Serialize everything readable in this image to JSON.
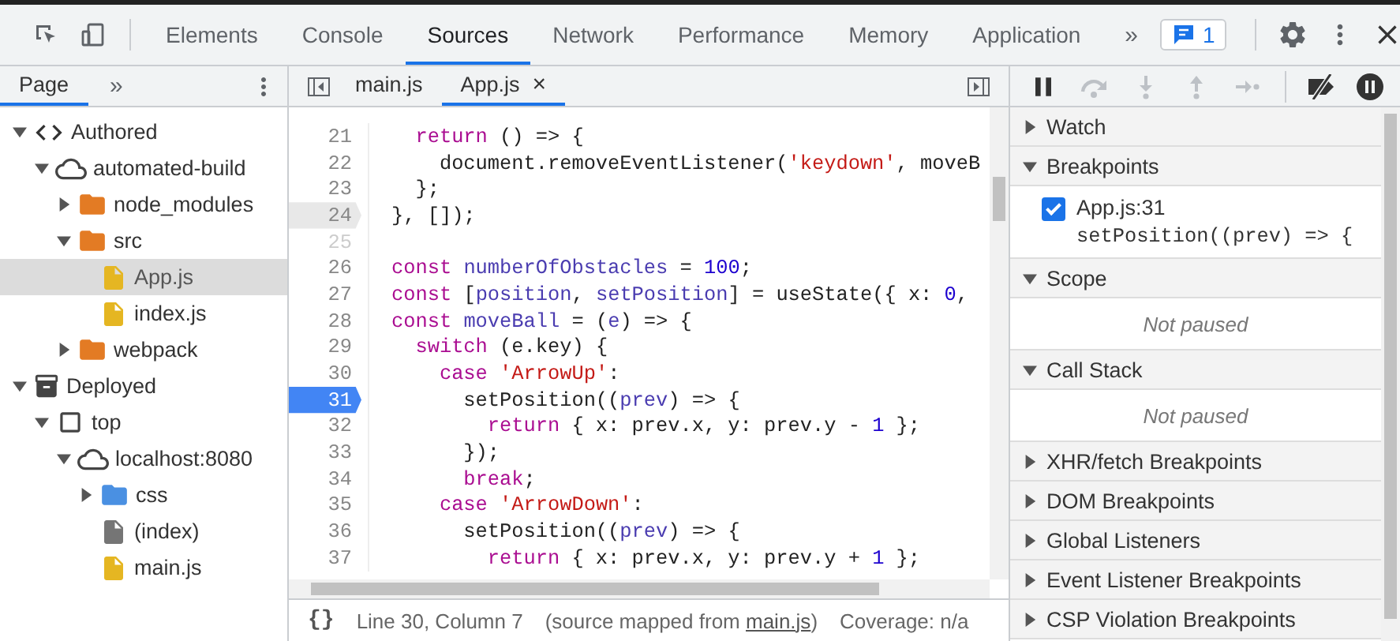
{
  "toolbar": {
    "tabs": [
      {
        "label": "Elements",
        "selected": false
      },
      {
        "label": "Console",
        "selected": false
      },
      {
        "label": "Sources",
        "selected": true
      },
      {
        "label": "Network",
        "selected": false
      },
      {
        "label": "Performance",
        "selected": false
      },
      {
        "label": "Memory",
        "selected": false
      },
      {
        "label": "Application",
        "selected": false
      }
    ],
    "overflow": "»",
    "issues_badge": "1"
  },
  "navigator": {
    "tabs": [
      {
        "label": "Page",
        "selected": true
      }
    ],
    "overflow": "»",
    "tree": [
      {
        "label": "Authored",
        "kind": "code",
        "expanded": true,
        "selected": false,
        "children": [
          {
            "label": "automated-build",
            "kind": "cloud",
            "expanded": true,
            "selected": false,
            "children": [
              {
                "label": "node_modules",
                "kind": "folder",
                "color": "#e37b24",
                "expanded": false,
                "selected": false
              },
              {
                "label": "src",
                "kind": "folder",
                "color": "#e37b24",
                "expanded": true,
                "selected": false,
                "children": [
                  {
                    "label": "App.js",
                    "kind": "file",
                    "color": "#e5b622",
                    "selected": true
                  },
                  {
                    "label": "index.js",
                    "kind": "file",
                    "color": "#e5b622",
                    "selected": false
                  }
                ]
              },
              {
                "label": "webpack",
                "kind": "folder",
                "color": "#e37b24",
                "expanded": false,
                "selected": false
              }
            ]
          }
        ]
      },
      {
        "label": "Deployed",
        "kind": "package",
        "expanded": true,
        "selected": false,
        "children": [
          {
            "label": "top",
            "kind": "frame",
            "expanded": true,
            "selected": false,
            "children": [
              {
                "label": "localhost:8080",
                "kind": "cloud",
                "expanded": true,
                "selected": false,
                "children": [
                  {
                    "label": "css",
                    "kind": "folder",
                    "color": "#4a90e2",
                    "expanded": false,
                    "selected": false
                  },
                  {
                    "label": "(index)",
                    "kind": "file",
                    "color": "#757575",
                    "selected": false
                  },
                  {
                    "label": "main.js",
                    "kind": "file",
                    "color": "#e5b622",
                    "selected": false
                  }
                ]
              }
            ]
          }
        ]
      }
    ]
  },
  "editor": {
    "tabs": [
      {
        "label": "main.js",
        "selected": false
      },
      {
        "label": "App.js",
        "selected": true,
        "close": "×"
      }
    ],
    "lines": [
      {
        "number": "21",
        "breakpoint": false,
        "breakpoint_disabled": false,
        "breakable": true,
        "tokens": [
          {
            "kind": "kw",
            "text": "  return"
          },
          {
            "kind": "plain",
            "text": " () => {"
          }
        ]
      },
      {
        "number": "22",
        "breakpoint": false,
        "breakpoint_disabled": false,
        "breakable": true,
        "tokens": [
          {
            "kind": "plain",
            "text": "    document.removeEventListener("
          },
          {
            "kind": "str",
            "text": "'keydown'"
          },
          {
            "kind": "plain",
            "text": ", moveB"
          }
        ]
      },
      {
        "number": "23",
        "breakpoint": false,
        "breakpoint_disabled": false,
        "breakable": true,
        "tokens": [
          {
            "kind": "plain",
            "text": "  };"
          }
        ]
      },
      {
        "number": "24",
        "breakpoint": false,
        "breakpoint_disabled": true,
        "breakable": true,
        "tokens": [
          {
            "kind": "plain",
            "text": "}, []);"
          }
        ]
      },
      {
        "number": "25",
        "breakpoint": false,
        "breakpoint_disabled": false,
        "breakable": false
      },
      {
        "number": "26",
        "breakpoint": false,
        "breakpoint_disabled": false,
        "breakable": true,
        "tokens": [
          {
            "kind": "kw",
            "text": "const "
          },
          {
            "kind": "def",
            "text": "numberOfObstacles"
          },
          {
            "kind": "plain",
            "text": " = "
          },
          {
            "kind": "num",
            "text": "100"
          },
          {
            "kind": "plain",
            "text": ";"
          }
        ]
      },
      {
        "number": "27",
        "breakpoint": false,
        "breakpoint_disabled": false,
        "breakable": true,
        "tokens": [
          {
            "kind": "kw",
            "text": "const"
          },
          {
            "kind": "plain",
            "text": " ["
          },
          {
            "kind": "def",
            "text": "position"
          },
          {
            "kind": "plain",
            "text": ", "
          },
          {
            "kind": "def",
            "text": "setPosition"
          },
          {
            "kind": "plain",
            "text": "] = useState({ x: "
          },
          {
            "kind": "num",
            "text": "0"
          },
          {
            "kind": "plain",
            "text": ","
          }
        ]
      },
      {
        "number": "28",
        "breakpoint": false,
        "breakpoint_disabled": false,
        "breakable": true,
        "tokens": [
          {
            "kind": "kw",
            "text": "const "
          },
          {
            "kind": "def",
            "text": "moveBall"
          },
          {
            "kind": "plain",
            "text": " = ("
          },
          {
            "kind": "def",
            "text": "e"
          },
          {
            "kind": "plain",
            "text": ") => {"
          }
        ]
      },
      {
        "number": "29",
        "breakpoint": false,
        "breakpoint_disabled": false,
        "breakable": true,
        "tokens": [
          {
            "kind": "kw",
            "text": "  switch"
          },
          {
            "kind": "plain",
            "text": " (e.key) {"
          }
        ]
      },
      {
        "number": "30",
        "breakpoint": false,
        "breakpoint_disabled": false,
        "breakable": true,
        "tokens": [
          {
            "kind": "kw",
            "text": "    case "
          },
          {
            "kind": "str",
            "text": "'ArrowUp'"
          },
          {
            "kind": "plain",
            "text": ":"
          }
        ]
      },
      {
        "number": "31",
        "breakpoint": true,
        "breakpoint_disabled": false,
        "breakable": true,
        "tokens": [
          {
            "kind": "plain",
            "text": "      setPosition(("
          },
          {
            "kind": "def",
            "text": "prev"
          },
          {
            "kind": "plain",
            "text": ") => {"
          }
        ]
      },
      {
        "number": "32",
        "breakpoint": false,
        "breakpoint_disabled": false,
        "breakable": true,
        "tokens": [
          {
            "kind": "kw",
            "text": "        return"
          },
          {
            "kind": "plain",
            "text": " { x: prev.x, y: prev.y - "
          },
          {
            "kind": "num",
            "text": "1"
          },
          {
            "kind": "plain",
            "text": " };"
          }
        ]
      },
      {
        "number": "33",
        "breakpoint": false,
        "breakpoint_disabled": false,
        "breakable": true,
        "tokens": [
          {
            "kind": "plain",
            "text": "      });"
          }
        ]
      },
      {
        "number": "34",
        "breakpoint": false,
        "breakpoint_disabled": false,
        "breakable": true,
        "tokens": [
          {
            "kind": "kw",
            "text": "      break"
          },
          {
            "kind": "plain",
            "text": ";"
          }
        ]
      },
      {
        "number": "35",
        "breakpoint": false,
        "breakpoint_disabled": false,
        "breakable": true,
        "tokens": [
          {
            "kind": "kw",
            "text": "    case "
          },
          {
            "kind": "str",
            "text": "'ArrowDown'"
          },
          {
            "kind": "plain",
            "text": ":"
          }
        ]
      },
      {
        "number": "36",
        "breakpoint": false,
        "breakpoint_disabled": false,
        "breakable": true,
        "tokens": [
          {
            "kind": "plain",
            "text": "      setPosition(("
          },
          {
            "kind": "def",
            "text": "prev"
          },
          {
            "kind": "plain",
            "text": ") => {"
          }
        ]
      },
      {
        "number": "37",
        "breakpoint": false,
        "breakpoint_disabled": false,
        "breakable": true,
        "tokens": [
          {
            "kind": "kw",
            "text": "        return"
          },
          {
            "kind": "plain",
            "text": " { x: prev.x, y: prev.y + "
          },
          {
            "kind": "num",
            "text": "1"
          },
          {
            "kind": "plain",
            "text": " };"
          }
        ]
      }
    ],
    "status": {
      "format_button": "{}",
      "position": "Line 30, Column 7",
      "source_map": {
        "before": "(source mapped from ",
        "link": "main.js",
        "after": ")"
      },
      "coverage": "Coverage: n/a"
    }
  },
  "debugger": {
    "paused": false,
    "sections": [
      {
        "title": "Watch",
        "expanded": false
      },
      {
        "title": "Breakpoints",
        "expanded": true,
        "breakpoints": [
          {
            "location": "App.js:31",
            "code": "setPosition((prev) => {",
            "checked": true
          }
        ]
      },
      {
        "title": "Scope",
        "expanded": true,
        "message": "Not paused"
      },
      {
        "title": "Call Stack",
        "expanded": true,
        "message": "Not paused"
      },
      {
        "title": "XHR/fetch Breakpoints",
        "expanded": false
      },
      {
        "title": "DOM Breakpoints",
        "expanded": false
      },
      {
        "title": "Global Listeners",
        "expanded": false
      },
      {
        "title": "Event Listener Breakpoints",
        "expanded": false
      },
      {
        "title": "CSP Violation Breakpoints",
        "expanded": false
      }
    ]
  }
}
